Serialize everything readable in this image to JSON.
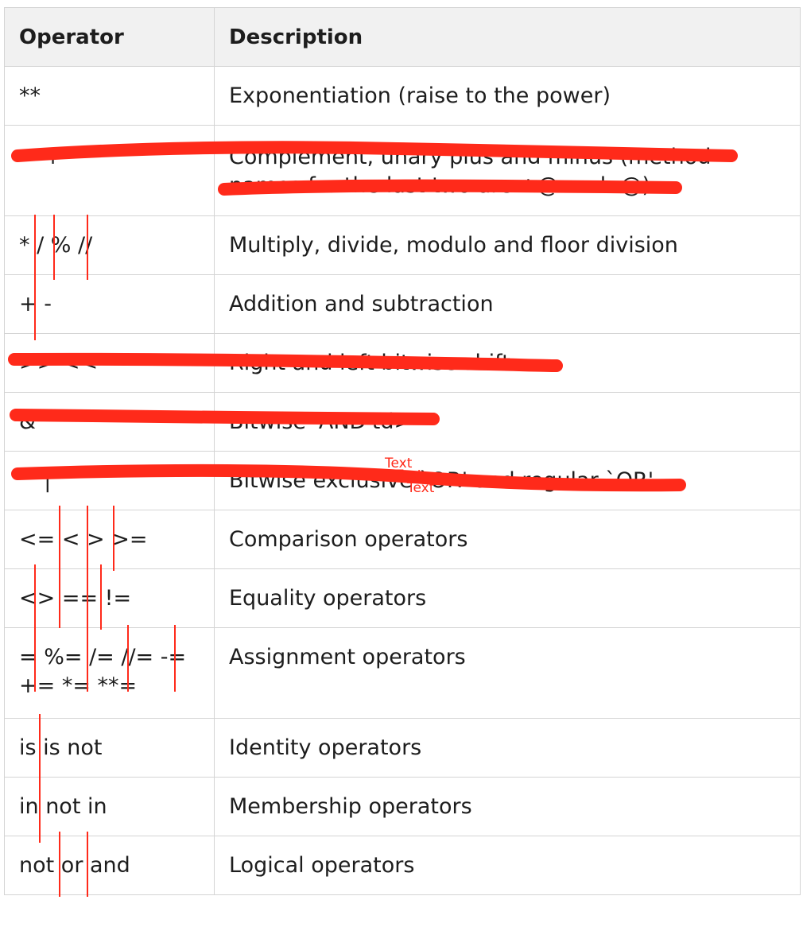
{
  "table": {
    "headers": {
      "operator": "Operator",
      "description": "Description"
    },
    "rows": [
      {
        "operator": "**",
        "description": "Exponentiation (raise to the power)"
      },
      {
        "operator": "~ + -",
        "description": "Complement, unary plus and minus (method names for the last two are +@ and -@)",
        "struck_out": true
      },
      {
        "operator": "* / % //",
        "description": "Multiply, divide, modulo and floor division"
      },
      {
        "operator": "+ -",
        "description": "Addition and subtraction"
      },
      {
        "operator": ">> <<",
        "description": "Right and left bitwise shift",
        "struck_out": true
      },
      {
        "operator": "&",
        "description": "Bitwise 'AND'td>",
        "struck_out": true
      },
      {
        "operator": "^ |",
        "description": "Bitwise exclusive `OR' and regular `OR'",
        "struck_out": true
      },
      {
        "operator": "<= < > >=",
        "description": "Comparison operators"
      },
      {
        "operator": "<> == !=",
        "description": "Equality operators"
      },
      {
        "operator": "= %= /= //= -= += *= **=",
        "description": "Assignment operators"
      },
      {
        "operator": "is is not",
        "description": "Identity operators"
      },
      {
        "operator": "in not in",
        "description": "Membership operators"
      },
      {
        "operator": "not or and",
        "description": "Logical operators"
      }
    ]
  },
  "annotations": {
    "stray_text": [
      "Text",
      "Text",
      "Text"
    ],
    "marker_color": "#ff2a1a"
  }
}
